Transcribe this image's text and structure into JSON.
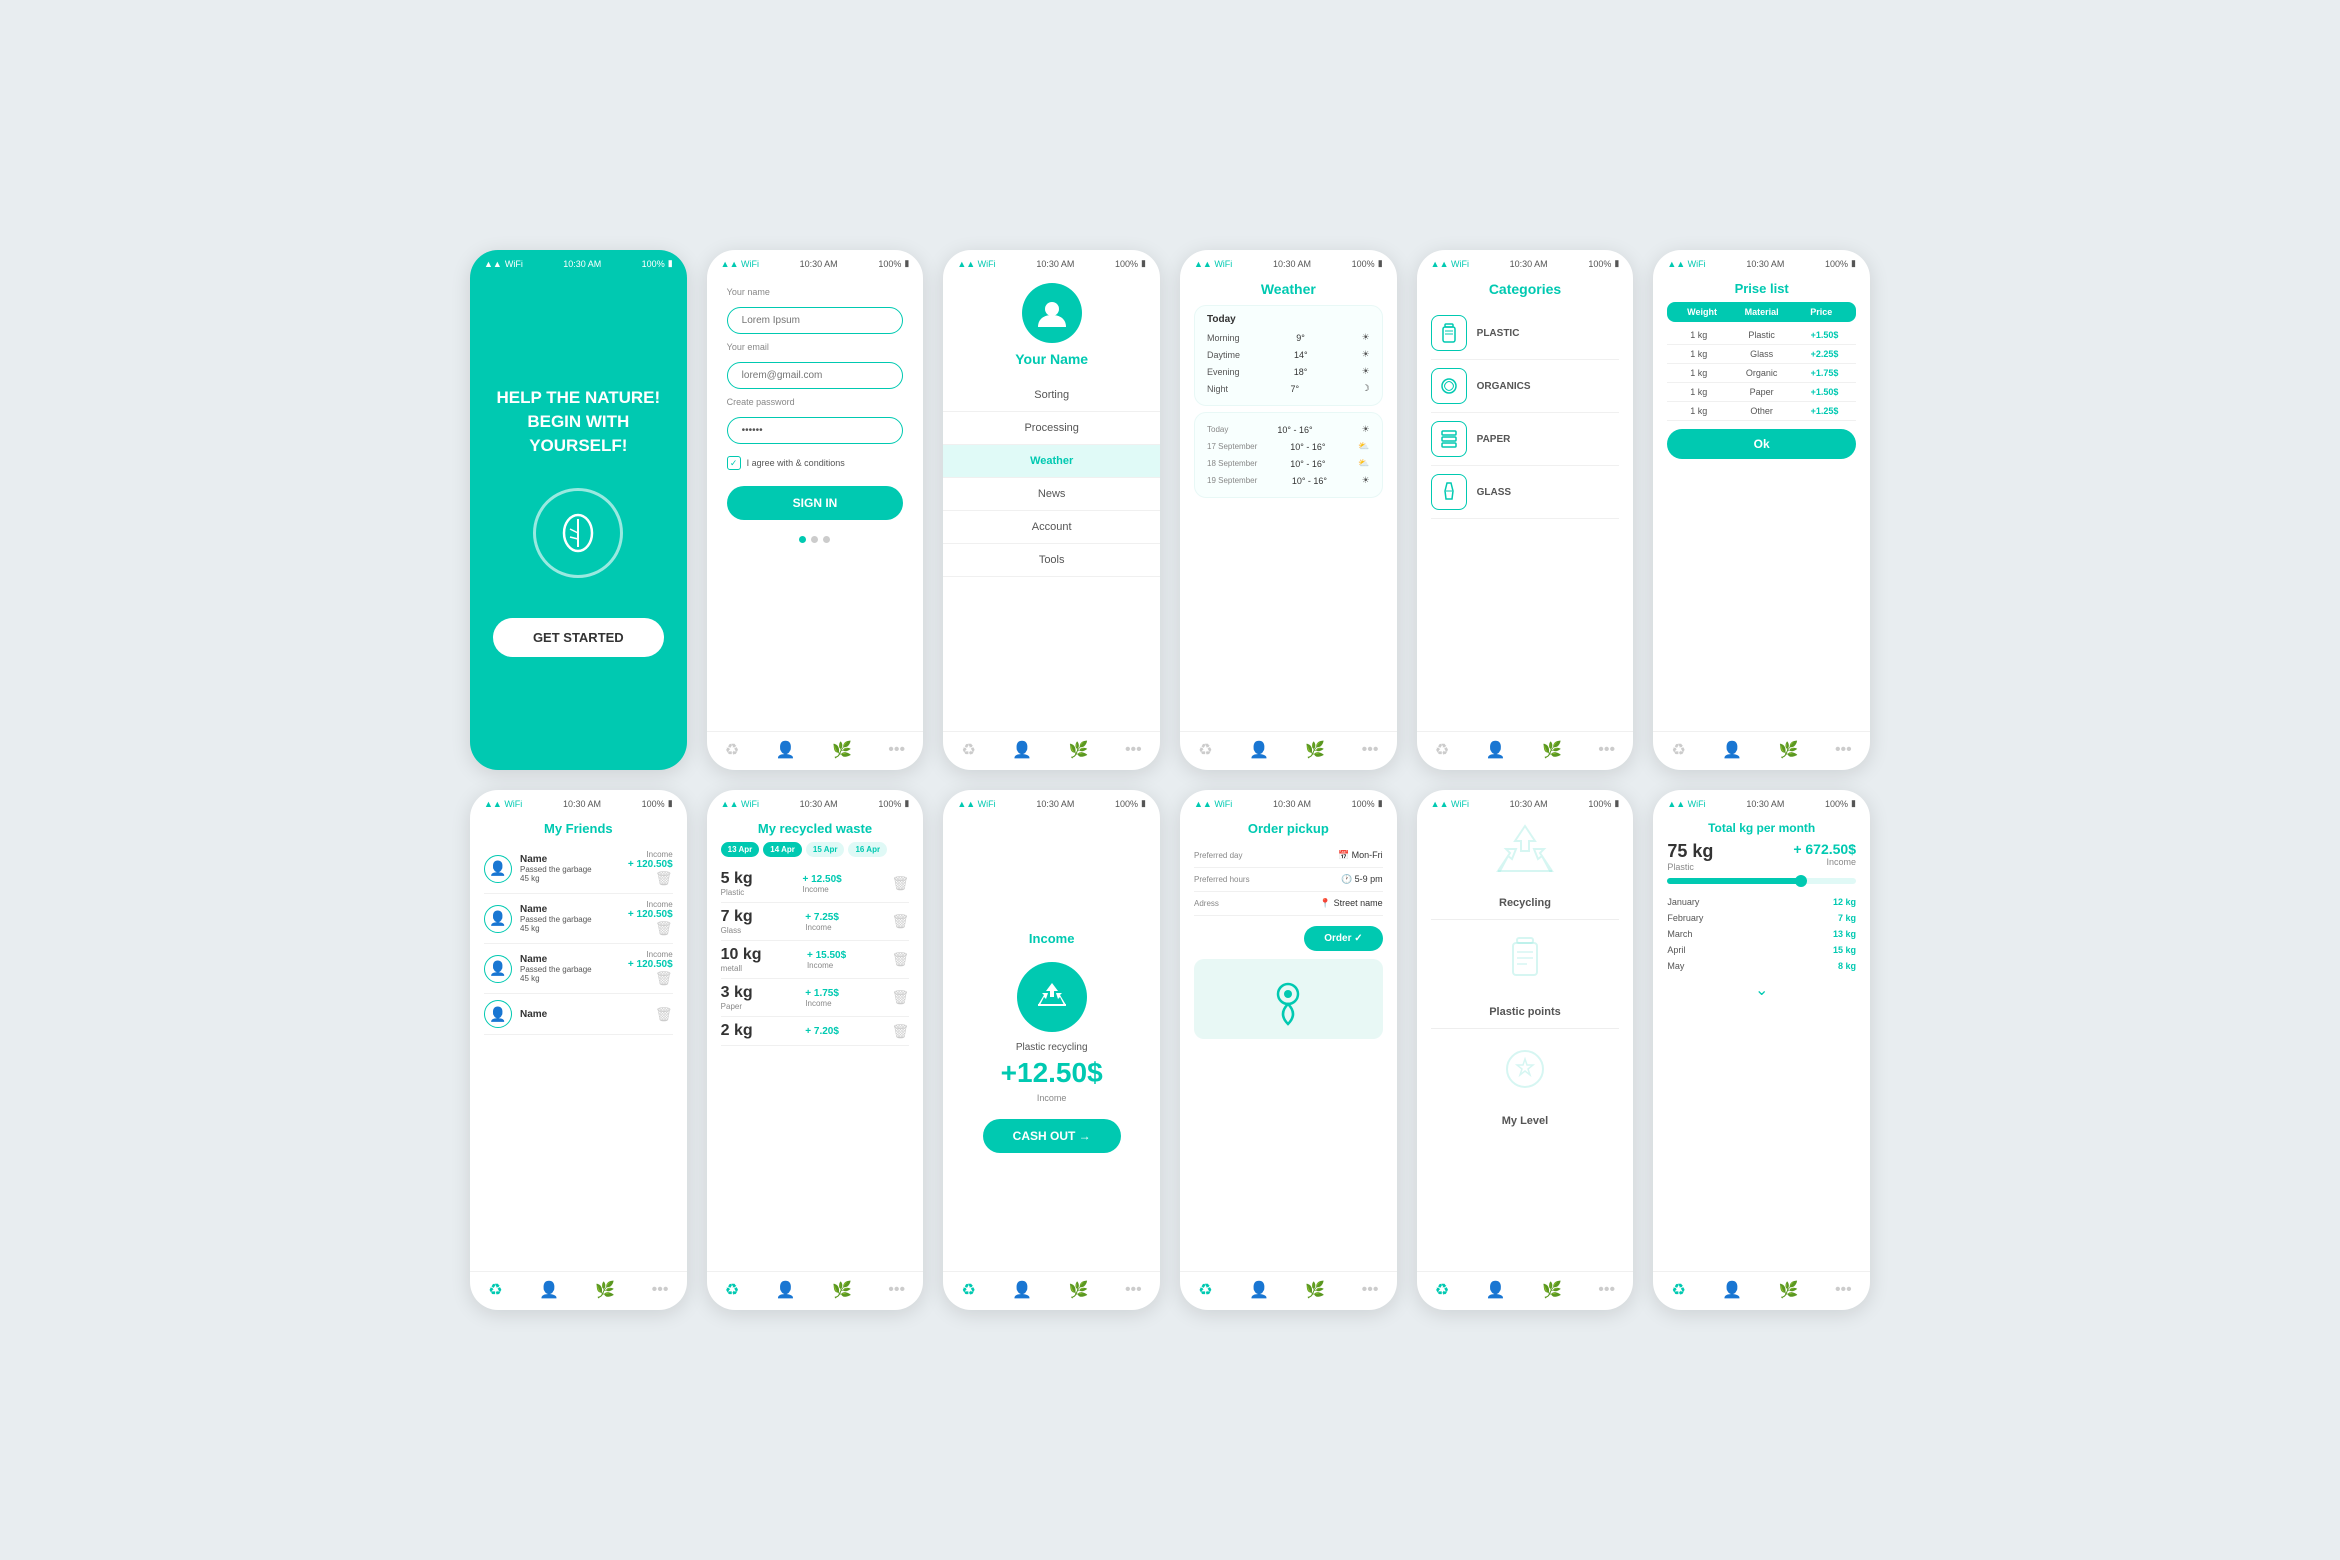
{
  "phones": {
    "p1": {
      "status_time": "10:30 AM",
      "status_battery": "100%",
      "title": "HELP THE NATURE!\nBEGIN WITH YOURSELF!",
      "btn_label": "GET STARTED"
    },
    "p2": {
      "status_time": "10:30 AM",
      "status_battery": "100%",
      "name_label": "Your name",
      "name_placeholder": "Lorem Ipsum",
      "email_label": "Your email",
      "email_placeholder": "lorem@gmail.com",
      "password_label": "Create password",
      "agree_label": "I agree with & conditions",
      "btn_label": "SIGN IN"
    },
    "p3": {
      "status_time": "10:30 AM",
      "status_battery": "100%",
      "profile_name": "Your Name",
      "menu": [
        "Sorting",
        "Processing",
        "Weather",
        "News",
        "Account",
        "Tools"
      ],
      "active_menu": 2
    },
    "p4": {
      "status_time": "10:30 AM",
      "status_battery": "100%",
      "title": "Weather",
      "today_label": "Today",
      "today_rows": [
        {
          "label": "Morning",
          "temp": "9°"
        },
        {
          "label": "Daytime",
          "temp": "14°"
        },
        {
          "label": "Evening",
          "temp": "18°"
        },
        {
          "label": "Night",
          "temp": "7°"
        }
      ],
      "forecast": [
        {
          "date": "Today",
          "temp": "10° - 16°"
        },
        {
          "date": "17 September",
          "temp": "10° - 16°"
        },
        {
          "date": "18 September",
          "temp": "10° - 16°"
        },
        {
          "date": "19 September",
          "temp": "10° - 16°"
        }
      ]
    },
    "p5": {
      "status_time": "10:30 AM",
      "status_battery": "100%",
      "title": "Categories",
      "categories": [
        "PLASTIC",
        "ORGANICS",
        "PAPER",
        "GLASS"
      ]
    },
    "p6": {
      "status_time": "10:30 AM",
      "status_battery": "100%",
      "title": "Prise list",
      "headers": [
        "Weight",
        "Material",
        "Price"
      ],
      "rows": [
        {
          "weight": "1 kg",
          "material": "Plastic",
          "price": "+1.50$"
        },
        {
          "weight": "1 kg",
          "material": "Glass",
          "price": "+2.25$"
        },
        {
          "weight": "1 kg",
          "material": "Organic",
          "price": "+1.75$"
        },
        {
          "weight": "1 kg",
          "material": "Paper",
          "price": "+1.50$"
        },
        {
          "weight": "1 kg",
          "material": "Other",
          "price": "+1.25$"
        }
      ],
      "ok_label": "Ok"
    },
    "p7": {
      "status_time": "10:30 AM",
      "status_battery": "100%",
      "title": "My Friends",
      "friends": [
        {
          "name": "Name",
          "kg": "45 kg",
          "income": "+ 120.50$"
        },
        {
          "name": "Name",
          "kg": "45 kg",
          "income": "+ 120.50$"
        },
        {
          "name": "Name",
          "kg": "45 kg",
          "income": "+ 120.50$"
        },
        {
          "name": "Name",
          "kg": "",
          "income": ""
        }
      ]
    },
    "p8": {
      "status_time": "10:30 AM",
      "status_battery": "100%",
      "title": "My recycled waste",
      "date_tabs": [
        "13 Apr",
        "14 Apr",
        "15 Apr",
        "16 Apr"
      ],
      "waste_rows": [
        {
          "kg": "5 kg",
          "type": "Plastic",
          "income": "+ 12.50$"
        },
        {
          "kg": "7 kg",
          "type": "Glass",
          "income": "+ 7.25$"
        },
        {
          "kg": "10 kg",
          "type": "metall",
          "income": "+ 15.50$"
        },
        {
          "kg": "3 kg",
          "type": "Paper",
          "income": "+ 1.75$"
        },
        {
          "kg": "2 kg",
          "type": "",
          "income": "+ 7.20$"
        }
      ]
    },
    "p9": {
      "status_time": "10:30 AM",
      "status_battery": "100%",
      "title": "Income",
      "item_label": "Plastic recycling",
      "amount": "+12.50$",
      "sub_label": "Income",
      "cash_out_label": "CASH OUT →"
    },
    "p10": {
      "status_time": "10:30 AM",
      "status_battery": "100%",
      "title": "Order pickup",
      "fields": [
        {
          "label": "Preferred day",
          "value": "Mon-Fri"
        },
        {
          "label": "Preferred hours",
          "value": "5-9 pm"
        },
        {
          "label": "Adress",
          "value": "Street name"
        }
      ],
      "order_label": "Order ✓"
    },
    "p11": {
      "status_time": "10:30 AM",
      "status_battery": "100%",
      "sections": [
        "Recycling",
        "Plastic points",
        "My Level"
      ]
    },
    "p12": {
      "status_time": "10:30 AM",
      "status_battery": "100%",
      "title": "Total kg per month",
      "total_kg": "75 kg",
      "total_kg_sub": "Plastic",
      "total_income": "+ 672.50$",
      "total_income_sub": "Income",
      "months": [
        {
          "month": "January",
          "kg": "12 kg"
        },
        {
          "month": "February",
          "kg": "7 kg"
        },
        {
          "month": "March",
          "kg": "13 kg"
        },
        {
          "month": "April",
          "kg": "15 kg"
        },
        {
          "month": "May",
          "kg": "8 kg"
        }
      ]
    }
  }
}
